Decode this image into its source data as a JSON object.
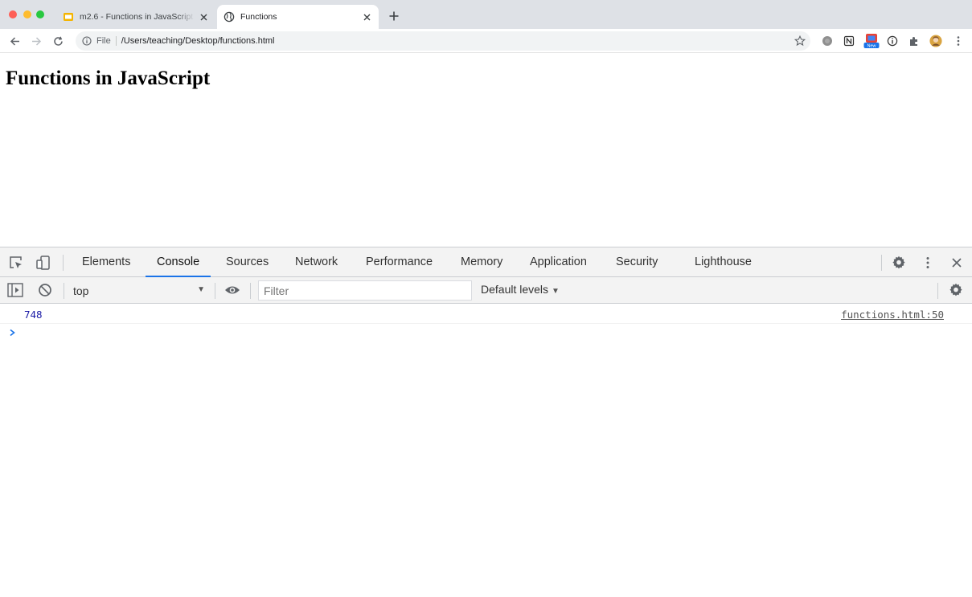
{
  "browser": {
    "tabs": [
      {
        "title": "m2.6 - Functions in JavaScript",
        "favicon": "slides-icon",
        "active": false
      },
      {
        "title": "Functions",
        "favicon": "globe-icon",
        "active": true
      }
    ],
    "address_bar": {
      "scheme_label": "File",
      "url": "/Users/teaching/Desktop/functions.html"
    },
    "extension_badge": "New"
  },
  "page": {
    "heading": "Functions in JavaScript"
  },
  "devtools": {
    "tabs": [
      "Elements",
      "Console",
      "Sources",
      "Network",
      "Performance",
      "Memory",
      "Application",
      "Security",
      "Lighthouse"
    ],
    "selected_tab": "Console",
    "console_toolbar": {
      "context": "top",
      "filter_placeholder": "Filter",
      "levels": "Default levels"
    },
    "messages": [
      {
        "value": "748",
        "source": "functions.html:50"
      }
    ],
    "accent_color": "#1a73e8",
    "value_color": "#1a1aa6"
  }
}
